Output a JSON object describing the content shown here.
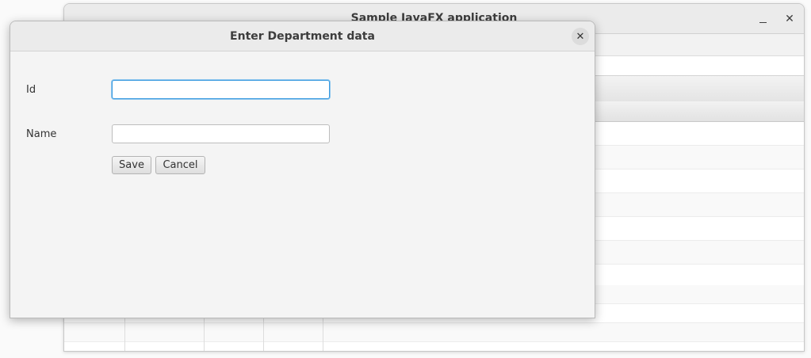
{
  "main_window": {
    "title": "Sample JavaFX application",
    "minimize_label": "–",
    "close_label": "✕"
  },
  "dialog": {
    "title": "Enter Department data",
    "close_label": "✕",
    "fields": {
      "id": {
        "label": "Id",
        "value": "",
        "placeholder": ""
      },
      "name": {
        "label": "Name",
        "value": "",
        "placeholder": ""
      }
    },
    "buttons": {
      "save": "Save",
      "cancel": "Cancel"
    }
  }
}
